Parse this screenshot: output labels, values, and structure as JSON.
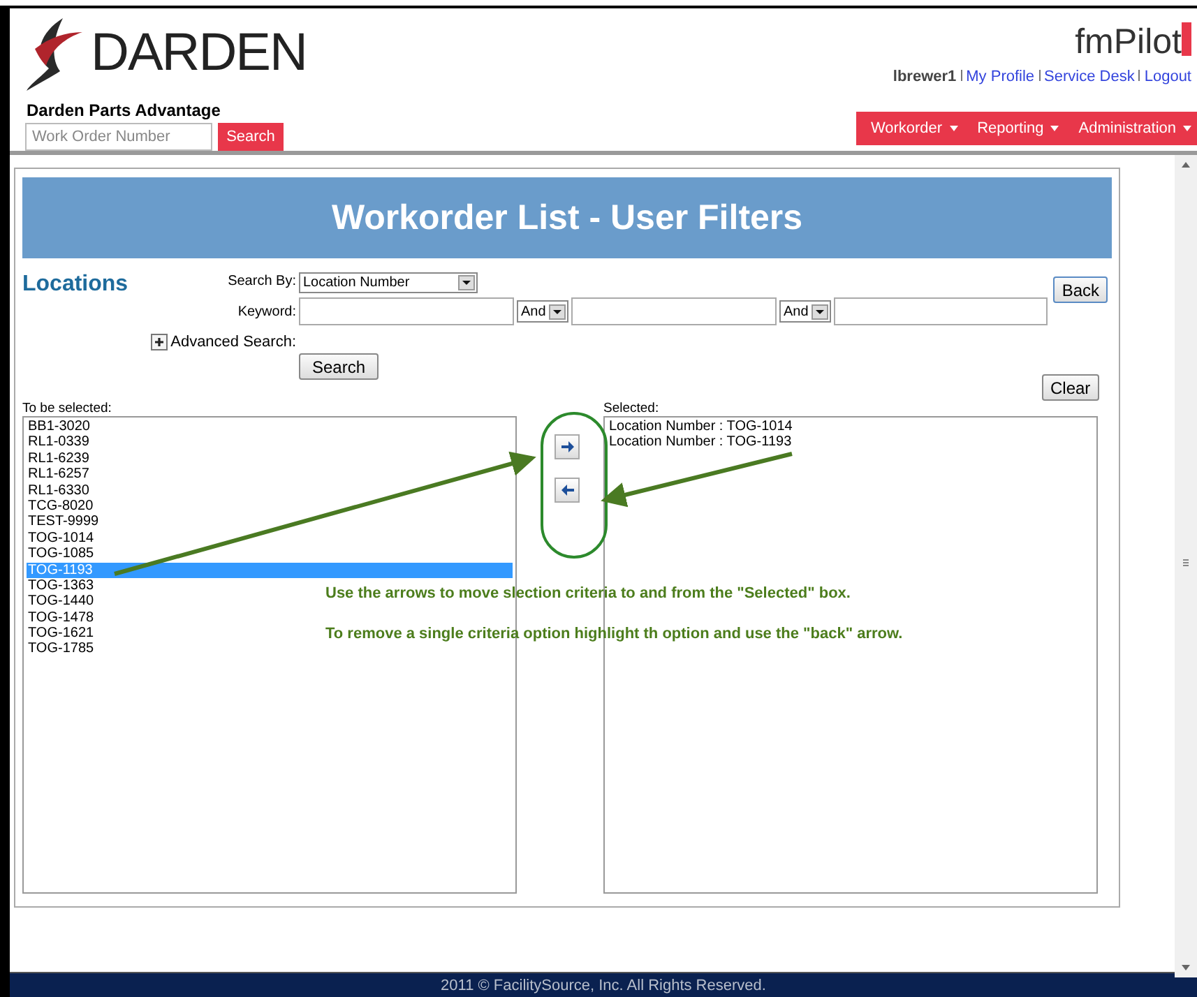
{
  "header": {
    "logo_text": "DARDEN",
    "app_name": "Darden Parts Advantage",
    "search": {
      "placeholder": "Work Order Number"
    },
    "search_button": "Search",
    "brand": "fmPilot",
    "user": "lbrewer1",
    "links": [
      "My Profile",
      "Service Desk",
      "Logout"
    ],
    "menu": [
      {
        "label": "Workorder"
      },
      {
        "label": "Reporting"
      },
      {
        "label": "Administration"
      }
    ]
  },
  "page": {
    "title": "Workorder List - User Filters",
    "section": "Locations",
    "search_by_label": "Search By:",
    "search_by_value": "Location Number",
    "keyword_label": "Keyword:",
    "conjunctions": [
      "And",
      "And"
    ],
    "advanced_search": "Advanced Search:",
    "search_button": "Search",
    "back_button": "Back",
    "clear_button": "Clear",
    "available_label": "To be selected:",
    "available": [
      {
        "label": "BB1-3020",
        "selected": false
      },
      {
        "label": "RL1-0339",
        "selected": false
      },
      {
        "label": "RL1-6239",
        "selected": false
      },
      {
        "label": "RL1-6257",
        "selected": false
      },
      {
        "label": "RL1-6330",
        "selected": false
      },
      {
        "label": "TCG-8020",
        "selected": false
      },
      {
        "label": "TEST-9999",
        "selected": false
      },
      {
        "label": "TOG-1014",
        "selected": false
      },
      {
        "label": "TOG-1085",
        "selected": false
      },
      {
        "label": "TOG-1193",
        "selected": true
      },
      {
        "label": "TOG-1363",
        "selected": false
      },
      {
        "label": "TOG-1440",
        "selected": false
      },
      {
        "label": "TOG-1478",
        "selected": false
      },
      {
        "label": "TOG-1621",
        "selected": false
      },
      {
        "label": "TOG-1785",
        "selected": false
      }
    ],
    "selected_label": "Selected:",
    "selected_items": [
      "Location Number : TOG-1014",
      "Location Number : TOG-1193"
    ],
    "instructions": [
      "Use the arrows to move slection criteria to and from the \"Selected\" box.",
      "To remove a single criteria option highlight th option and use the \"back\" arrow."
    ]
  },
  "footer": "2011 © FacilitySource, Inc. All Rights Reserved."
}
